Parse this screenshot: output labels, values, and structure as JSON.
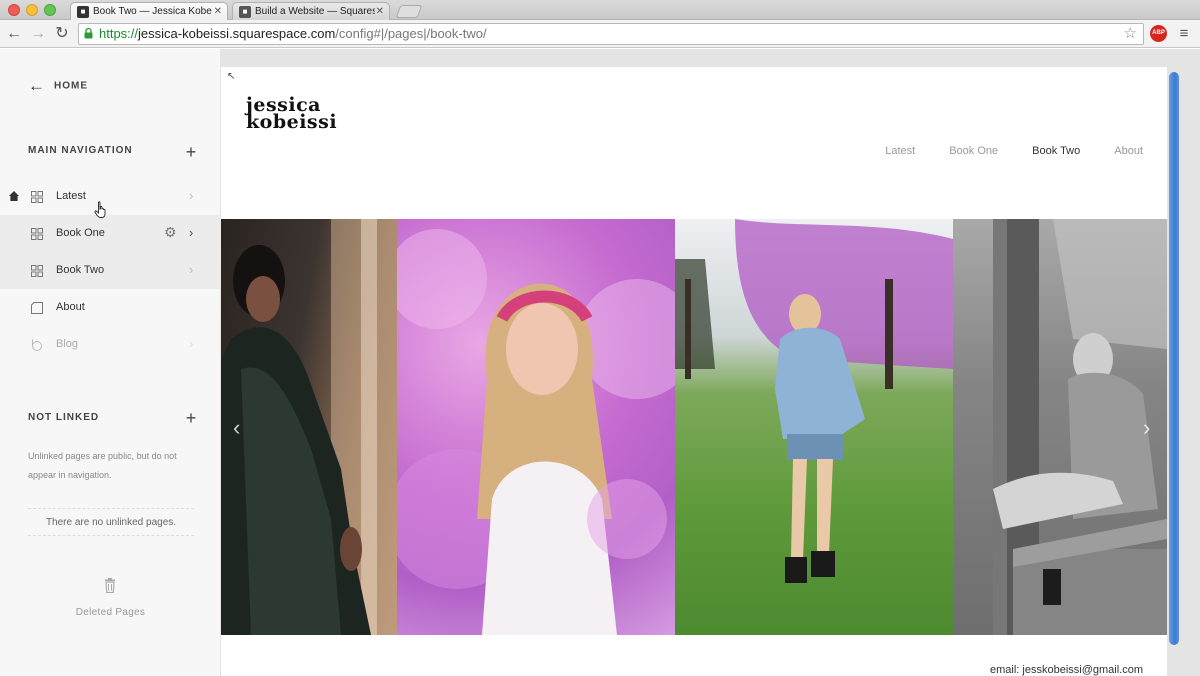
{
  "browser": {
    "tabs": [
      {
        "title": "Book Two — Jessica Kobe",
        "active": true
      },
      {
        "title": "Build a Website — Squares",
        "active": false
      }
    ],
    "url": {
      "scheme": "https://",
      "host": "jessica-kobeissi.squarespace.com",
      "path": "/config#|/pages|/book-two/"
    },
    "icons": [
      "back-icon",
      "forward-icon",
      "reload-icon",
      "lock-icon",
      "star-icon",
      "adblock-icon",
      "menu-icon"
    ],
    "colors": {
      "url_scheme": "#1a8a2a",
      "adblock": "#d7261f"
    }
  },
  "sidebar": {
    "home_label": "HOME",
    "main_nav_title": "MAIN NAVIGATION",
    "pages": [
      {
        "label": "Latest",
        "icon": "grid-icon",
        "is_home": true
      },
      {
        "label": "Book One",
        "icon": "grid-icon",
        "highlighted": true,
        "has_settings": true
      },
      {
        "label": "Book Two",
        "icon": "grid-icon",
        "highlighted": true
      },
      {
        "label": "About",
        "icon": "page-icon"
      },
      {
        "label": "Blog",
        "icon": "blog-icon",
        "disabled": true
      }
    ],
    "not_linked_title": "NOT LINKED",
    "not_linked_desc": "Unlinked pages are public, but do not appear in navigation.",
    "no_unlinked": "There are no unlinked pages.",
    "deleted_label": "Deleted Pages"
  },
  "site": {
    "logo_line1": "jessica",
    "logo_line2": "kobeissi",
    "nav": [
      {
        "label": "Latest",
        "active": false
      },
      {
        "label": "Book One",
        "active": false
      },
      {
        "label": "Book Two",
        "active": true
      },
      {
        "label": "About",
        "active": false
      }
    ],
    "gallery_slides": [
      {
        "subject": "woman-in-sequin-gown",
        "tone": "dark"
      },
      {
        "subject": "girl-with-flower-crown-pink-blossoms",
        "tone": "pink"
      },
      {
        "subject": "girl-in-denim-jacket-on-grass",
        "tone": "green"
      },
      {
        "subject": "girl-on-fence-black-and-white",
        "tone": "grayscale"
      }
    ],
    "footer_email": "email: jesskobeissi@gmail.com",
    "scrollbar_color": "#3d7ad3"
  }
}
